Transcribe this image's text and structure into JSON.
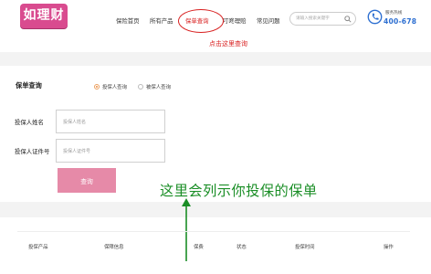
{
  "brand": {
    "logo_text": "如理财"
  },
  "nav": {
    "items": [
      {
        "label": "保险首页"
      },
      {
        "label": "所有产品"
      },
      {
        "label": "保单查询"
      },
      {
        "label": "叮咚理赔"
      },
      {
        "label": "常见问题"
      }
    ]
  },
  "search": {
    "placeholder": "请输入搜索关键字"
  },
  "hotline": {
    "label": "服务热线",
    "number": "400-678"
  },
  "annotations": {
    "top_hint": "点击这里查询",
    "main_hint": "这里会列示你投保的保单",
    "colors": {
      "red": "#d81f1f",
      "green": "#1a8e26"
    }
  },
  "query": {
    "title": "保单查询",
    "options": [
      {
        "label": "投保人查询",
        "selected": true
      },
      {
        "label": "被保人查询",
        "selected": false
      }
    ],
    "name_label": "投保人姓名",
    "name_placeholder": "投保人姓名",
    "id_label": "投保人证件号",
    "id_placeholder": "投保人证件号",
    "button": "查询"
  },
  "table": {
    "columns": [
      "投保产品",
      "保障信息",
      "保费",
      "状态",
      "投保时间",
      "操作"
    ]
  },
  "colors": {
    "accent": "#d94b8f",
    "button": "#e68aa8",
    "radio": "#f08a3a",
    "hotline": "#2d6fd1"
  }
}
